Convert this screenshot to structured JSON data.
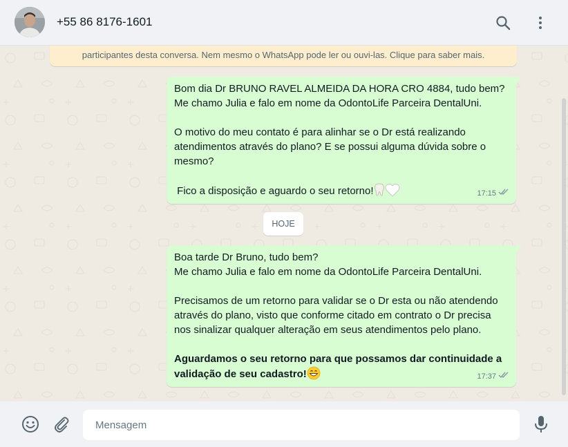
{
  "header": {
    "contact_name": "+55 86 8176-1601",
    "icons": [
      "avatar",
      "search-icon",
      "menu-icon"
    ]
  },
  "encryption_notice": "participantes desta conversa. Nem mesmo o WhatsApp pode ler ou ouvi-las. Clique para saber mais.",
  "messages": [
    {
      "direction": "outgoing",
      "paragraphs": [
        "Bom dia Dr BRUNO RAVEL ALMEIDA DA HORA CRO 4884, tudo bem?\nMe chamo Julia e falo em nome da OdontoLife Parceira DentalUni.",
        "O motivo do meu contato é para alinhar se o Dr está realizando atendimentos através do plano? E se possui alguma dúvida sobre o mesmo?",
        " Fico a disposição e aguardo o seu retorno!"
      ],
      "emojis": [
        "tooth-emoji",
        "white-heart-emoji"
      ],
      "time": "17:15",
      "status": "read"
    },
    {
      "direction": "outgoing",
      "paragraphs": [
        "Boa tarde Dr Bruno, tudo bem?\nMe chamo Julia e falo em nome da OdontoLife Parceira DentalUni.",
        "Precisamos de um retorno para validar se o Dr esta ou não atendendo através do plano, visto que conforme citado em contrato o Dr precisa nos sinalizar qualquer alteração em seus atendimentos pelo plano."
      ],
      "bold_paragraph": "Aguardamos o seu retorno para que possamos dar continuidade a validação de seu cadastro!",
      "emojis": [
        "grinning-emoji"
      ],
      "time": "17:37",
      "status": "read"
    }
  ],
  "day_separator": "HOJE",
  "footer": {
    "input_placeholder": "Mensagem",
    "icons": [
      "emoji-icon",
      "attach-icon",
      "mic-icon"
    ]
  },
  "colors": {
    "outgoing_bubble": "#d9fdd3",
    "chat_background": "#efeae2",
    "header_background": "#f0f2f5",
    "encryption_background": "#ffeecd",
    "read_ticks": "#8696a0"
  }
}
